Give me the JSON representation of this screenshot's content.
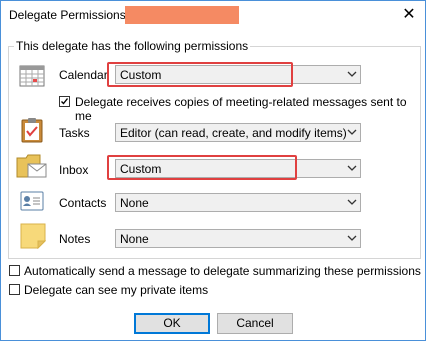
{
  "window": {
    "title": "Delegate Permissions:",
    "close_glyph": "✕"
  },
  "group": {
    "legend": "This delegate has the following permissions"
  },
  "rows": {
    "calendar": {
      "label": "Calendar",
      "value": "Custom",
      "icon": "calendar-icon"
    },
    "tasks": {
      "label": "Tasks",
      "value": "Editor (can read, create, and modify items)",
      "icon": "clipboard-icon"
    },
    "inbox": {
      "label": "Inbox",
      "value": "Custom",
      "icon": "inbox-folder-icon"
    },
    "contacts": {
      "label": "Contacts",
      "value": "None",
      "icon": "contact-card-icon"
    },
    "notes": {
      "label": "Notes",
      "value": "None",
      "icon": "sticky-note-icon"
    }
  },
  "checkboxes": {
    "meeting_copies": {
      "label": "Delegate receives copies of meeting-related messages sent to me",
      "checked": true
    },
    "auto_send": {
      "label": "Automatically send a message to delegate summarizing these permissions",
      "checked": false
    },
    "private_items": {
      "label": "Delegate can see my private items",
      "checked": false
    }
  },
  "buttons": {
    "ok": "OK",
    "cancel": "Cancel"
  },
  "colors": {
    "redaction": "#f58a63",
    "highlight": "#e04040",
    "accent": "#0078d7"
  }
}
